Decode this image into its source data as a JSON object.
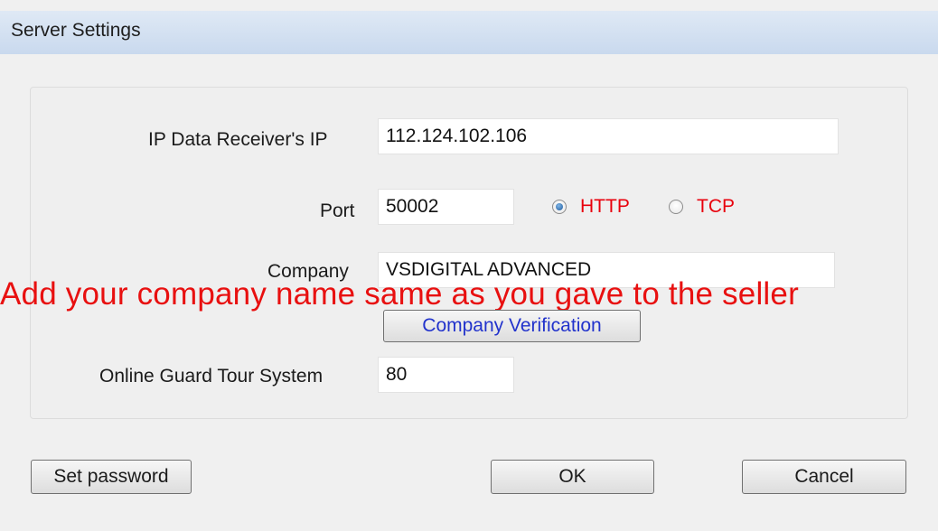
{
  "window": {
    "title": "Server Settings"
  },
  "form": {
    "ip_label": "IP Data Receiver's IP",
    "ip_value": "112.124.102.106",
    "port_label": "Port",
    "port_value": "50002",
    "protocol": {
      "selected": "HTTP",
      "options": [
        "HTTP",
        "TCP"
      ]
    },
    "company_label": "Company",
    "company_value": "VSDIGITAL ADVANCED",
    "verify_button": "Company Verification",
    "guard_label": "Online Guard Tour System",
    "guard_value": "80"
  },
  "annotation": {
    "text": "Add your company name same as you gave to the seller",
    "color": "#e81010"
  },
  "footer": {
    "set_password": "Set password",
    "ok": "OK",
    "cancel": "Cancel"
  },
  "colors": {
    "titlebar": "#c9d9ee",
    "radio_label": "#e8000c",
    "verify_text": "#2233cc"
  }
}
